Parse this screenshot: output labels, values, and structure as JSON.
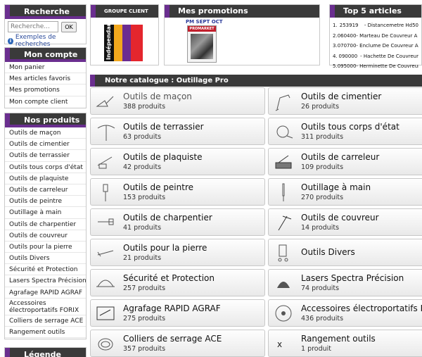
{
  "search": {
    "title": "Recherche",
    "placeholder": "Recherche...",
    "ok_label": "OK",
    "examples_label": "Exemples de recherches"
  },
  "account": {
    "title": "Mon compte",
    "items": [
      "Mon panier",
      "Mes articles favoris",
      "Mes promotions",
      "Mon compte client"
    ]
  },
  "products": {
    "title": "Nos produits",
    "items": [
      "Outils de maçon",
      "Outils de cimentier",
      "Outils de terrassier",
      "Outils tous corps d'état",
      "Outils de plaquiste",
      "Outils de carreleur",
      "Outils de peintre",
      "Outillage à main",
      "Outils de charpentier",
      "Outils de couvreur",
      "Outils pour la pierre",
      "Outils Divers",
      "Sécurité et Protection",
      "Lasers Spectra Précision",
      "Agrafage RAPID AGRAF",
      "Accessoires électroportatifs FORIX",
      "Colliers de serrage ACE",
      "Rangement outils"
    ]
  },
  "legend": {
    "title": "Légende"
  },
  "group": {
    "title": "GROUPE CLIENT",
    "logo_text": "Indépendant"
  },
  "promotions": {
    "title": "Mes promotions",
    "label": "PM SEPT OCT",
    "cover_text": "PROMARKET"
  },
  "top5": {
    "title": "Top 5 articles",
    "items": [
      {
        "num": "1.",
        "code": "253919",
        "name": "- Distancemetre Hd50"
      },
      {
        "num": "2.",
        "code": "060400",
        "name": "- Marteau De Couvreur A Gaine"
      },
      {
        "num": "3.",
        "code": "070700",
        "name": "- Enclume De Couvreur A Gaine"
      },
      {
        "num": "4.",
        "code": "090000",
        "name": "- Hachette De Couvreur"
      },
      {
        "num": "5.",
        "code": "095000",
        "name": "- Herminette De Couvreur"
      }
    ]
  },
  "catalog": {
    "title": "Notre catalogue : Outillage Pro",
    "tiles": [
      {
        "name": "Outils de maçon",
        "count": "388 produits",
        "icon": "trowel-icon"
      },
      {
        "name": "Outils de cimentier",
        "count": "26 produits",
        "icon": "float-icon"
      },
      {
        "name": "Outils de terrassier",
        "count": "63 produits",
        "icon": "pickaxe-icon"
      },
      {
        "name": "Outils tous corps d'état",
        "count": "311 produits",
        "icon": "tape-measure-icon"
      },
      {
        "name": "Outils de plaquiste",
        "count": "42 produits",
        "icon": "drywall-tool-icon"
      },
      {
        "name": "Outils de carreleur",
        "count": "109 produits",
        "icon": "tile-cutter-icon"
      },
      {
        "name": "Outils de peintre",
        "count": "153 produits",
        "icon": "paint-brush-icon"
      },
      {
        "name": "Outillage à main",
        "count": "270 produits",
        "icon": "screwdriver-icon"
      },
      {
        "name": "Outils de charpentier",
        "count": "41 produits",
        "icon": "hammer-icon"
      },
      {
        "name": "Outils de couvreur",
        "count": "14 produits",
        "icon": "roofer-hammer-icon"
      },
      {
        "name": "Outils pour la pierre",
        "count": "21 produits",
        "icon": "chisel-icon"
      },
      {
        "name": "Outils Divers",
        "count": "",
        "icon": "cart-icon"
      },
      {
        "name": "Sécurité et Protection",
        "count": "257 produits",
        "icon": "helmet-icon"
      },
      {
        "name": "Lasers Spectra Précision",
        "count": "74 produits",
        "icon": "laser-level-icon"
      },
      {
        "name": "Agrafage RAPID AGRAF",
        "count": "275 produits",
        "icon": "stapler-icon"
      },
      {
        "name": "Accessoires électroportatifs FORIX",
        "count": "436 produits",
        "icon": "saw-blade-icon"
      },
      {
        "name": "Colliers de serrage ACE",
        "count": "357 produits",
        "icon": "hose-clamp-icon"
      },
      {
        "name": "Rangement outils",
        "count": "1 produit",
        "icon": "missing-image-icon"
      }
    ]
  },
  "colors": {
    "accent": "#6a2e8f",
    "header": "#3a3a3a",
    "link": "#2a4a9a"
  }
}
